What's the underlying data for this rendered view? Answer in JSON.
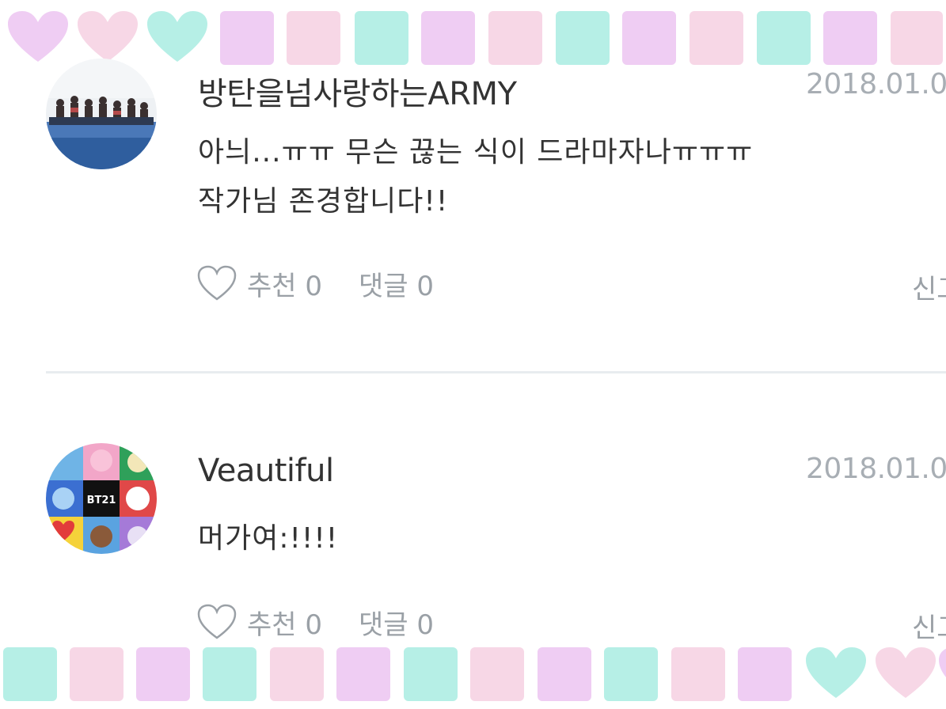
{
  "colors": {
    "pink": "#f7d7e6",
    "lavender": "#efcdf3",
    "mint": "#b6efe6",
    "text": "#333333",
    "muted": "#9aa0a6",
    "date": "#a8aeb4"
  },
  "comments": [
    {
      "username": "방탄을넘사랑하는ARMY",
      "date": "2018.01.0",
      "lines": [
        "아늬...ㅠㅠ 무슨 끊는 식이 드라마자나ㅠㅠㅠ",
        "작가님 존경합니다!!"
      ],
      "like_label": "추천 0",
      "reply_label": "댓글 0",
      "report_label": "신고"
    },
    {
      "username": "Veautiful",
      "date": "2018.01.0",
      "lines": [
        "머가여:!!!!"
      ],
      "like_label": "추천 0",
      "reply_label": "댓글 0",
      "report_label": "신고"
    }
  ],
  "icons": {
    "like": "heart-outline-icon",
    "border_heart": "heart-icon"
  }
}
